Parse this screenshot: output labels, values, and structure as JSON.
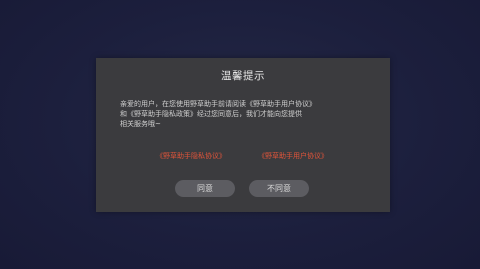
{
  "dialog": {
    "title": "温馨提示",
    "message_line1": "亲爱的用户，在您使用野草助手前请阅读《野草助手用户协议》",
    "message_line2": "和《野草助手隐私政策》经过您同意后，我们才能向您提供",
    "message_line3": "相关服务哦~",
    "privacy_link": "《野草助手隐私协议》",
    "user_agreement_link": "《野草助手用户协议》",
    "agree_button": "同意",
    "disagree_button": "不同意"
  },
  "colors": {
    "background": "#1b1e3c",
    "dialog": "#3b3b3e",
    "link": "#e0543a",
    "button": "#5c5c61"
  }
}
